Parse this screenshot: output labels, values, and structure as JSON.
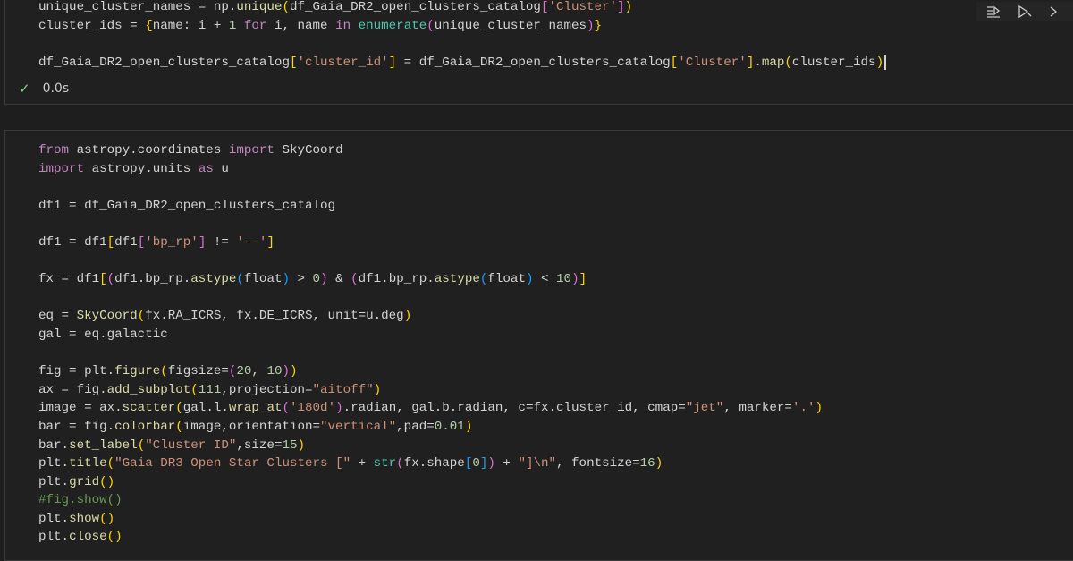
{
  "cell1": {
    "lines": [
      "unique_cluster_names = np.unique(df_Gaia_DR2_open_clusters_catalog['Cluster'])",
      "cluster_ids = {name: i + 1 for i, name in enumerate(unique_cluster_names)}",
      "",
      "df_Gaia_DR2_open_clusters_catalog['cluster_id'] = df_Gaia_DR2_open_clusters_catalog['Cluster'].map(cluster_ids)"
    ],
    "status": {
      "icon": "check-icon",
      "time": "0.0s",
      "color": "#89d185"
    },
    "toolbar": {
      "buttons": [
        "run-by-line-icon",
        "run-cell-icon"
      ]
    }
  },
  "cell2": {
    "lines": [
      "from astropy.coordinates import SkyCoord",
      "import astropy.units as u",
      "",
      "df1 = df_Gaia_DR2_open_clusters_catalog",
      "",
      "df1 = df1[df1['bp_rp'] != '--']",
      "",
      "fx = df1[(df1.bp_rp.astype(float) > 0) & (df1.bp_rp.astype(float) < 10)]",
      "",
      "eq = SkyCoord(fx.RA_ICRS, fx.DE_ICRS, unit=u.deg)",
      "gal = eq.galactic",
      "",
      "fig = plt.figure(figsize=(20, 10))",
      "ax = fig.add_subplot(111,projection=\"aitoff\")",
      "image = ax.scatter(gal.l.wrap_at('180d').radian, gal.b.radian, c=fx.cluster_id, cmap=\"jet\", marker='.')",
      "bar = fig.colorbar(image,orientation=\"vertical\",pad=0.01)",
      "bar.set_label(\"Cluster ID\",size=15)",
      "plt.title(\"Gaia DR3 Open Star Clusters [\" + str(fx.shape[0]) + \"]\\n\", fontsize=16)",
      "plt.grid()",
      "#fig.show()",
      "plt.show()",
      "plt.close()"
    ]
  },
  "theme": {
    "background": "#1e1e1e",
    "keyword": "#c586c0",
    "function": "#dcdcaa",
    "string": "#ce9178",
    "number": "#b5cea8",
    "comment": "#6a9955"
  }
}
